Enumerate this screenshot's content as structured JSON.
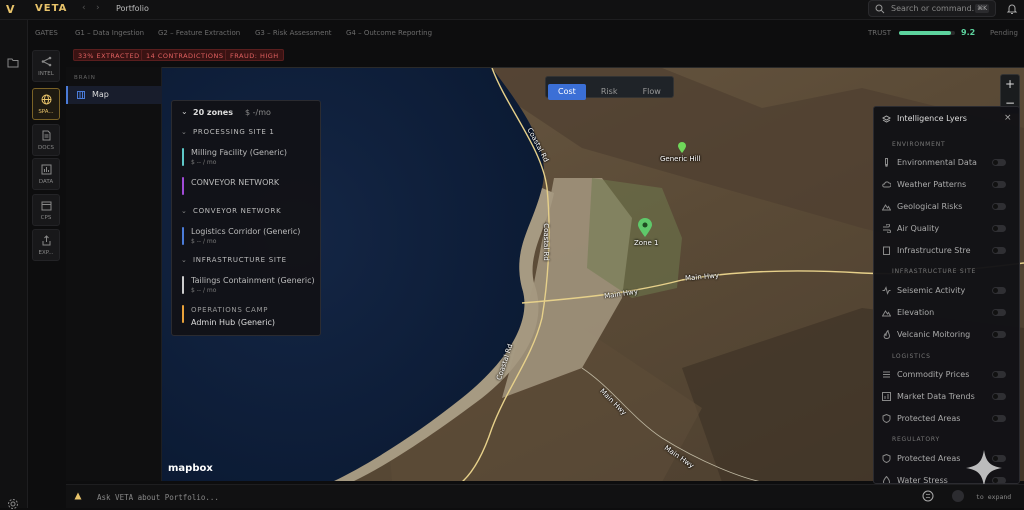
{
  "app": {
    "logo_letter": "V",
    "brand": "VETA",
    "breadcrumb": "Portfolio"
  },
  "search": {
    "placeholder": "Search or command...",
    "shortcut": "⌘K"
  },
  "gates": {
    "label": "GATES",
    "items": [
      "G1 – Data Ingestion",
      "G2 – Feature Extraction",
      "G3 – Risk Assessment",
      "G4 – Outcome Reporting"
    ],
    "trust_label": "TRUST",
    "trust_value": "9.2",
    "trust_fraction": 0.92,
    "status": "Pending"
  },
  "badges": [
    "33% EXTRACTED",
    "14 CONTRADICTIONS",
    "FRAUD: HIGH"
  ],
  "tools": [
    {
      "label": "INTEL",
      "icon": "share-icon"
    },
    {
      "label": "SPA...",
      "icon": "globe-icon",
      "active": true
    },
    {
      "label": "DOCS",
      "icon": "document-icon"
    },
    {
      "label": "DATA",
      "icon": "chart-icon"
    },
    {
      "label": "CPS",
      "icon": "calendar-icon"
    },
    {
      "label": "EXP...",
      "icon": "export-icon"
    }
  ],
  "brain": {
    "header": "BRAIN",
    "item": "Map"
  },
  "map": {
    "modes": [
      "Cost",
      "Risk",
      "Flow"
    ],
    "active_mode": "Cost",
    "labels": {
      "coast_rd_1": "Coastal Rd",
      "coast_rd_2": "Coastal Rd",
      "coast_rd_3": "Coastal Rd",
      "main_hwy_1": "Main Hwy",
      "main_hwy_2": "Main Hwy",
      "main_hwy_3": "Main Hwy",
      "main_hwy_4": "Main Hwy",
      "generic_hill": "Generic Hill",
      "zone_1": "Zone 1"
    },
    "attribution": "mapbox",
    "zoom_in": "+",
    "zoom_out": "−"
  },
  "zones": {
    "count": "20 zones",
    "cost": "$ -/mo",
    "groups": [
      {
        "title": "PROCESSING SITE 1",
        "items": [
          {
            "name": "Milling Facility (Generic)",
            "cost": "$ -- / mo",
            "color": "#5ec8c8"
          },
          {
            "name": "CONVEYOR NETWORK",
            "cost": "",
            "color": "#a04ad6"
          }
        ]
      },
      {
        "title": "CONVEYOR NETWORK",
        "items": [
          {
            "name": "Logistics Corridor (Generic)",
            "cost": "$ -- / mo",
            "color": "#4a7bd8"
          }
        ]
      },
      {
        "title": "INFRASTRUCTURE SITE",
        "items": [
          {
            "name": "Tailings Containment (Generic)",
            "cost": "$ -- / mo",
            "color": "#cccccc"
          }
        ]
      }
    ],
    "camp": {
      "title": "OPERATIONS CAMP",
      "name": "Admin Hub (Generic)",
      "color": "#e8a13a"
    }
  },
  "layers": {
    "title": "Intelligence Lyers",
    "sections": [
      {
        "title": "ENVIRONMENT",
        "items": [
          "Environmental Data",
          "Weather Patterns",
          "Geological Risks",
          "Air Quality",
          "Infrastructure Stre"
        ]
      },
      {
        "title": "INFRASTRUCTURE SITE",
        "items": [
          "Seisemic Activity",
          "Elevation",
          "Velcanic Moitoring"
        ]
      },
      {
        "title": "LOGISTICS",
        "items": [
          "Commodity Prices",
          "Market Data Trends",
          "Protected Areas"
        ]
      },
      {
        "title": "REGULATORY",
        "items": [
          "Protected Areas",
          "Water Stress"
        ]
      }
    ]
  },
  "bottom": {
    "ask_placeholder": "Ask VETA about Portfolio...",
    "expand": "to expand"
  },
  "colors": {
    "accent": "#e8c36a",
    "active_blue": "#3b6fd6",
    "trust_green": "#5dd39e",
    "alert_red": "#e06060"
  }
}
